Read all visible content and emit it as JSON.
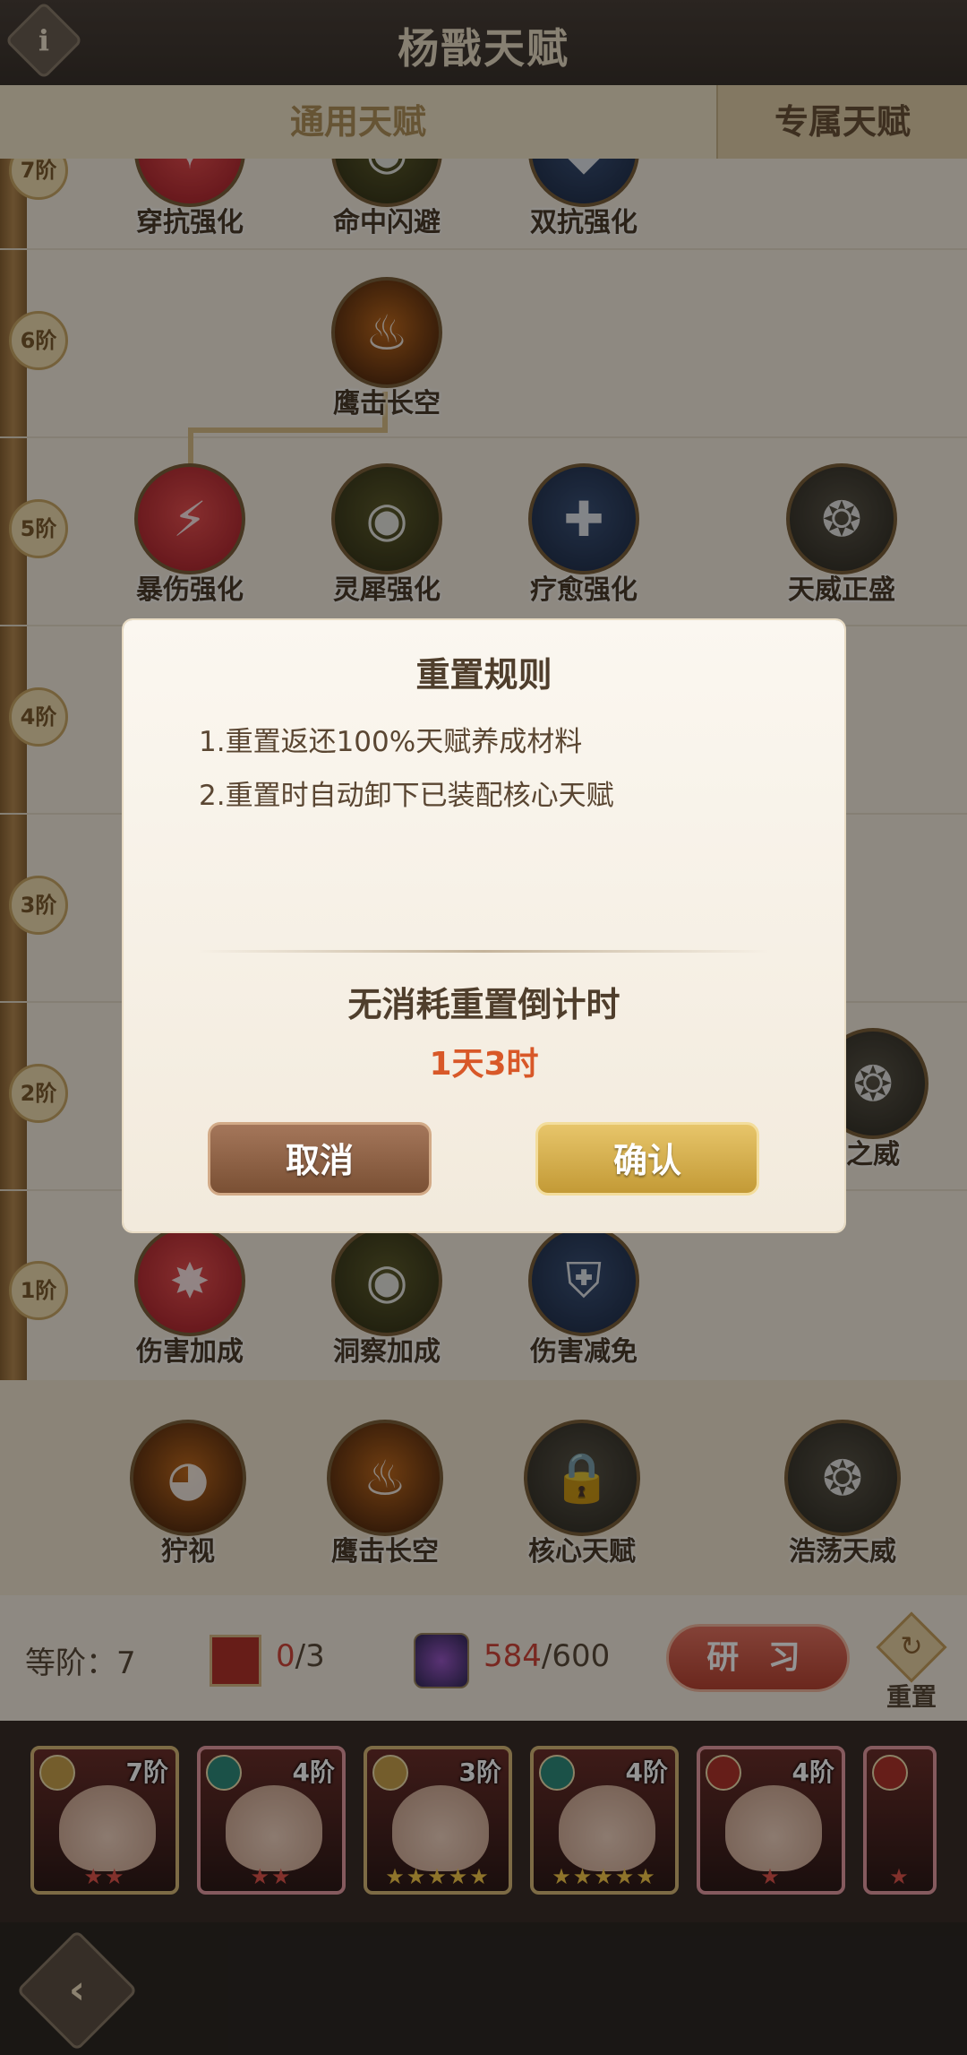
{
  "header": {
    "title": "杨戬天赋",
    "info_icon": "i"
  },
  "tabs": [
    {
      "label": "通用天赋",
      "active": true
    },
    {
      "label": "专属天赋",
      "active": false
    }
  ],
  "tiers": [
    "7阶",
    "6阶",
    "5阶",
    "4阶",
    "3阶",
    "2阶",
    "1阶"
  ],
  "tree": {
    "tier7": [
      "穿抗强化",
      "命中闪避",
      "双抗强化"
    ],
    "tier6": [
      "鹰击长空"
    ],
    "tier5": [
      "暴伤强化",
      "灵犀强化",
      "疗愈强化",
      "天威正盛"
    ],
    "tier2_partial": "之威",
    "tier1": [
      "伤害加成",
      "洞察加成",
      "伤害减免"
    ]
  },
  "core": [
    "狞视",
    "鹰击长空",
    "核心天赋",
    "浩荡天威"
  ],
  "stats": {
    "grade_label": "等阶：",
    "grade_value": "7",
    "cards_current": "0",
    "cards_total": "/3",
    "orbs_current": "584",
    "orbs_total": "/600",
    "study_label": "研 习",
    "reset_label": "重置"
  },
  "heroes": [
    {
      "tier": "7阶",
      "stars": "★★",
      "star_color": "red",
      "faction": "gold",
      "border": "gold"
    },
    {
      "tier": "4阶",
      "stars": "★★",
      "star_color": "red",
      "faction": "teal",
      "border": "pink"
    },
    {
      "tier": "3阶",
      "stars": "★★★★★",
      "star_color": "gold",
      "faction": "gold",
      "border": "gold"
    },
    {
      "tier": "4阶",
      "stars": "★★★★★",
      "star_color": "gold",
      "faction": "teal",
      "border": "gold"
    },
    {
      "tier": "4阶",
      "stars": "★",
      "star_color": "red",
      "faction": "red",
      "border": "pink"
    },
    {
      "tier": "",
      "stars": "★",
      "star_color": "red",
      "faction": "red",
      "border": "pink"
    }
  ],
  "dialog": {
    "title": "重置规则",
    "rule1": "1.重置返还100%天赋养成材料",
    "rule2": "2.重置时自动卸下已装配核心天赋",
    "countdown_label": "无消耗重置倒计时",
    "countdown_value": "1天3时",
    "cancel_label": "取消",
    "confirm_label": "确认"
  },
  "colors": {
    "accent_red": "#d0453a",
    "countdown": "#d85828",
    "confirm": "#e7c56a",
    "cancel": "#a4765a"
  }
}
